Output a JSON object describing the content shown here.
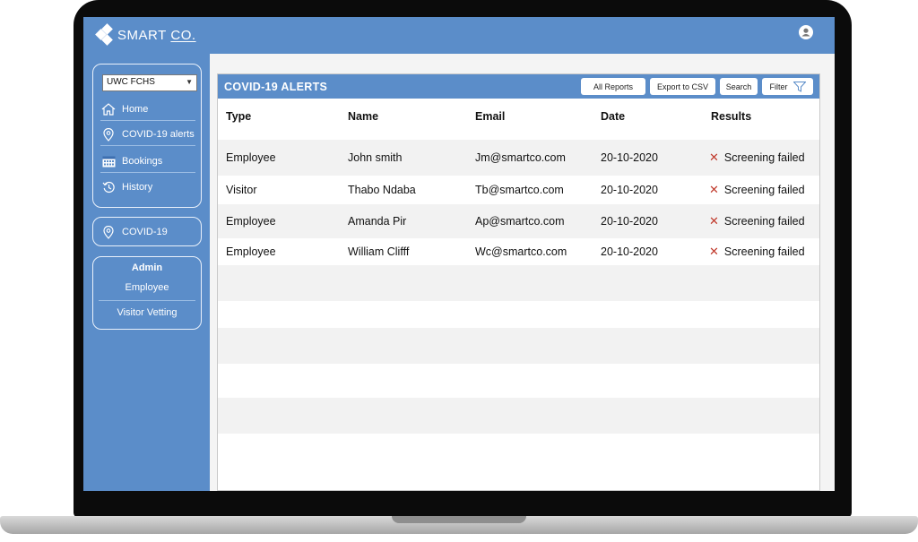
{
  "app": {
    "logo_text": "SMART",
    "logo_suffix": "CO."
  },
  "sidebar": {
    "location_select": "UWC FCHS",
    "nav_items": [
      {
        "label": "Home",
        "icon": "home-icon"
      },
      {
        "label": "COVID-19 alerts",
        "icon": "location-pin-icon"
      },
      {
        "label": "Bookings",
        "icon": "calendar-icon"
      },
      {
        "label": "History",
        "icon": "history-icon"
      }
    ],
    "covid_item": {
      "label": "COVID-19",
      "icon": "location-pin-icon"
    },
    "admin": {
      "title": "Admin",
      "items": [
        "Employee",
        "Visitor Vetting"
      ]
    }
  },
  "alerts": {
    "title": "COVID-19 ALERTS",
    "buttons": {
      "all_reports": "All Reports",
      "export_csv": "Export to CSV",
      "search": "Search",
      "filter": "Filter"
    },
    "columns": [
      "Type",
      "Name",
      "Email",
      "Date",
      "Results"
    ],
    "rows": [
      {
        "type": "Employee",
        "name": "John smith",
        "email": "Jm@smartco.com",
        "date": "20-10-2020",
        "result": "Screening failed"
      },
      {
        "type": "Visitor",
        "name": "Thabo Ndaba",
        "email": "Tb@smartco.com",
        "date": "20-10-2020",
        "result": "Screening failed"
      },
      {
        "type": "Employee",
        "name": "Amanda Pir",
        "email": "Ap@smartco.com",
        "date": "20-10-2020",
        "result": "Screening failed"
      },
      {
        "type": "Employee",
        "name": "William Clifff",
        "email": "Wc@smartco.com",
        "date": "20-10-2020",
        "result": "Screening failed"
      }
    ]
  },
  "colors": {
    "brand_blue": "#5b8dc9",
    "fail_red": "#c0392b",
    "row_stripe": "#f2f2f2"
  }
}
